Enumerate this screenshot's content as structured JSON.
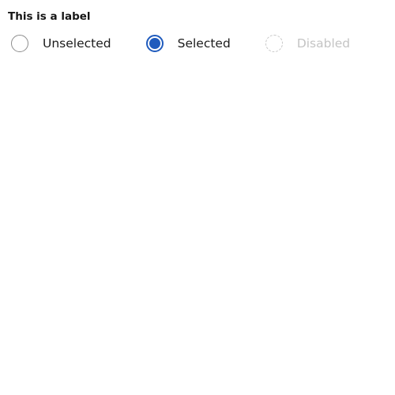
{
  "radio_group": {
    "label": "This is a label",
    "options": [
      {
        "label": "Unselected",
        "state": "unselected"
      },
      {
        "label": "Selected",
        "state": "selected"
      },
      {
        "label": "Disabled",
        "state": "disabled"
      }
    ]
  },
  "colors": {
    "accent": "#1f5bbd",
    "border": "#8d8d8d",
    "disabled": "#c4c4c4"
  }
}
